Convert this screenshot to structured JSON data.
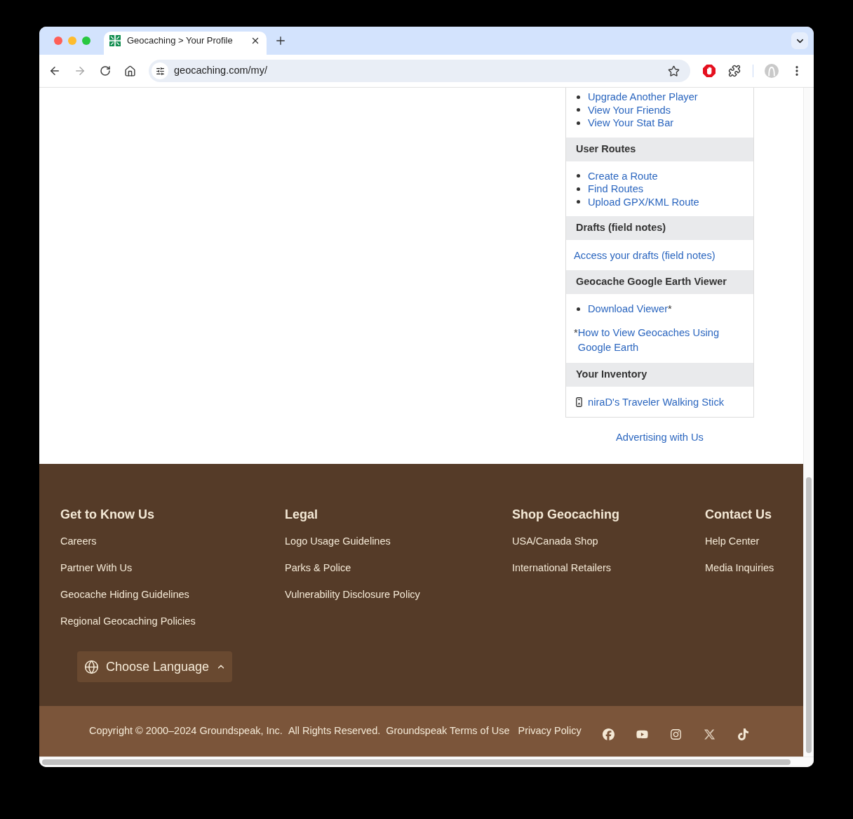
{
  "browser": {
    "tabs": [
      {
        "title": "Geocaching > Your Profile",
        "selected": true
      }
    ],
    "back": {
      "disabled": false
    },
    "forward": {
      "disabled": true
    },
    "address": "geocaching.com/my/"
  },
  "sidebar": {
    "sections": [
      {
        "items": [
          {
            "kind": "bullet",
            "text": "Upgrade Another Player"
          },
          {
            "kind": "bullet",
            "text": "View Your Friends"
          },
          {
            "kind": "bullet",
            "text": "View Your Stat Bar"
          }
        ]
      },
      {
        "heading": "User Routes",
        "items": [
          {
            "kind": "bullet",
            "text": "Create a Route"
          },
          {
            "kind": "bullet",
            "text": "Find Routes"
          },
          {
            "kind": "bullet",
            "text": "Upload GPX/KML Route"
          }
        ]
      },
      {
        "heading": "Drafts (field notes)",
        "items": [
          {
            "kind": "plain",
            "text": "Access your drafts (field notes)"
          }
        ]
      },
      {
        "heading": "Geocache Google Earth Viewer",
        "items": [
          {
            "kind": "bullet",
            "text": "Download Viewer",
            "suffix": "*"
          },
          {
            "kind": "note",
            "prefix": "*",
            "text": "How to View Geocaches Using Google Earth"
          }
        ]
      },
      {
        "heading": "Your Inventory",
        "items": [
          {
            "kind": "trackable",
            "text": "niraD's Traveler Walking Stick"
          }
        ]
      }
    ],
    "advertising": "Advertising with Us"
  },
  "footer": {
    "columns": [
      {
        "heading": "Get to Know Us",
        "links": [
          "Careers",
          "Partner With Us",
          "Geocache Hiding Guidelines",
          "Regional Geocaching Policies"
        ]
      },
      {
        "heading": "Legal",
        "links": [
          "Logo Usage Guidelines",
          "Parks & Police",
          "Vulnerability Disclosure Policy"
        ]
      },
      {
        "heading": "Shop Geocaching",
        "links": [
          "USA/Canada Shop",
          "International Retailers"
        ]
      },
      {
        "heading": "Contact Us",
        "links": [
          "Help Center",
          "Media Inquiries"
        ]
      }
    ],
    "language_button": "Choose Language"
  },
  "legal_bar": {
    "copyright": [
      "Copyright © 2000–2024 Groundspeak, Inc.",
      "All Rights Reserved."
    ],
    "links": [
      "Groundspeak Terms of Use",
      "Privacy Policy"
    ]
  }
}
